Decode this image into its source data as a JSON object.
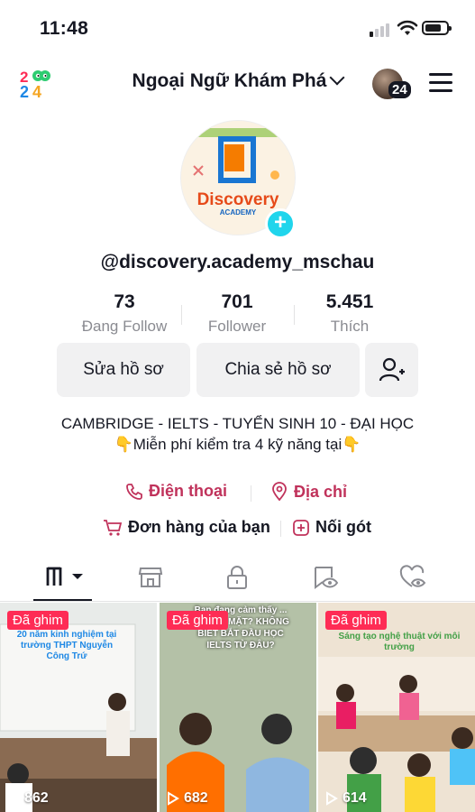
{
  "status_bar": {
    "time": "11:48"
  },
  "header": {
    "logo_text": "2024",
    "account_name": "Ngoại Ngữ Khám Phá",
    "notification_count": "24"
  },
  "profile": {
    "avatar_text": {
      "line1": "Discovery",
      "line2": "ACADEMY"
    },
    "handle": "@discovery.academy_mschau",
    "stats": [
      {
        "value": "73",
        "label": "Đang Follow"
      },
      {
        "value": "701",
        "label": "Follower"
      },
      {
        "value": "5.451",
        "label": "Thích"
      }
    ],
    "buttons": {
      "edit": "Sửa hồ sơ",
      "share": "Chia sẻ hồ sơ"
    },
    "bio_line1": "CAMBRIDGE - IELTS - TUYỂN SINH 10 - ĐẠI HỌC",
    "bio_line2": "👇Miễn phí kiểm tra 4 kỹ năng tại👇",
    "links": {
      "phone": "Điện thoại",
      "address": "Địa chỉ"
    },
    "shop": {
      "orders": "Đơn hàng của bạn",
      "connect": "Nối gót"
    }
  },
  "videos": [
    {
      "pin_label": "Đã ghim",
      "views": "862",
      "caption": "20 năm kinh nghiệm tại trường THPT Nguyễn Công Trứ"
    },
    {
      "pin_label": "Đã ghim",
      "views": "682",
      "caption": "Bạn đang cảm thấy ... CHÓNG MẶT? KHÔNG BIẾT BẮT ĐẦU HỌC IELTS TỪ ĐÂU?"
    },
    {
      "pin_label": "Đã ghim",
      "views": "614",
      "caption": "Sáng tạo nghệ thuật với môi trường"
    }
  ],
  "colors": {
    "accent": "#fe2c55",
    "link": "#c0325b",
    "plus": "#20d5ec"
  }
}
